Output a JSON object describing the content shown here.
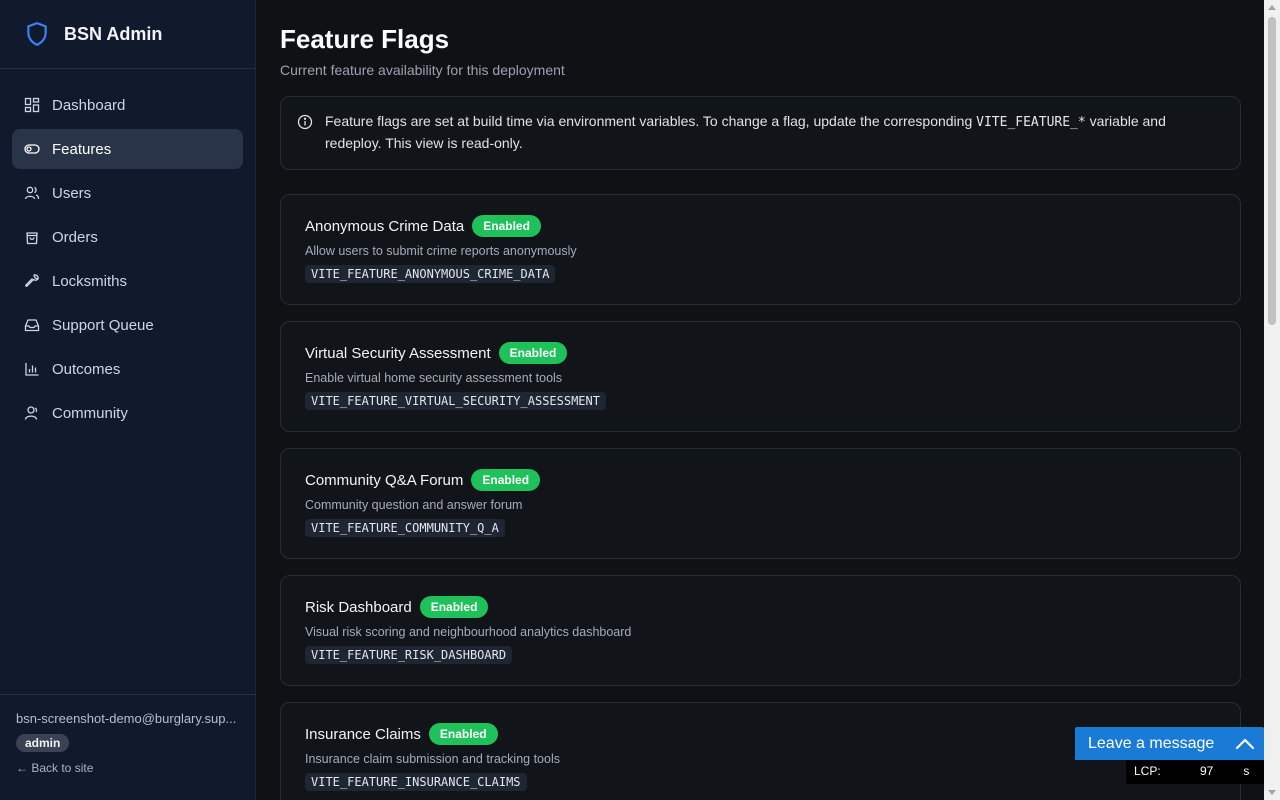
{
  "app": {
    "title": "BSN Admin"
  },
  "sidebar": {
    "items": [
      {
        "label": "Dashboard",
        "icon": "dashboard-icon"
      },
      {
        "label": "Features",
        "icon": "toggle-icon",
        "active": true
      },
      {
        "label": "Users",
        "icon": "users-icon"
      },
      {
        "label": "Orders",
        "icon": "bag-icon"
      },
      {
        "label": "Locksmiths",
        "icon": "wrench-icon"
      },
      {
        "label": "Support Queue",
        "icon": "inbox-icon"
      },
      {
        "label": "Outcomes",
        "icon": "bar-chart-icon"
      },
      {
        "label": "Community",
        "icon": "user-circle-icon"
      }
    ],
    "footer": {
      "email": "bsn-screenshot-demo@burglary.sup...",
      "role": "admin",
      "back_link": "← Back to site"
    }
  },
  "main": {
    "title": "Feature Flags",
    "subtitle": "Current feature availability for this deployment",
    "info": {
      "text_before": "Feature flags are set at build time via environment variables. To change a flag, update the corresponding ",
      "code": "VITE_FEATURE_*",
      "text_after": " variable and redeploy. This view is read-only."
    },
    "flags": [
      {
        "name": "Anonymous Crime Data",
        "status": "Enabled",
        "description": "Allow users to submit crime reports anonymously",
        "env": "VITE_FEATURE_ANONYMOUS_CRIME_DATA"
      },
      {
        "name": "Virtual Security Assessment",
        "status": "Enabled",
        "description": "Enable virtual home security assessment tools",
        "env": "VITE_FEATURE_VIRTUAL_SECURITY_ASSESSMENT"
      },
      {
        "name": "Community Q&A Forum",
        "status": "Enabled",
        "description": "Community question and answer forum",
        "env": "VITE_FEATURE_COMMUNITY_Q_A"
      },
      {
        "name": "Risk Dashboard",
        "status": "Enabled",
        "description": "Visual risk scoring and neighbourhood analytics dashboard",
        "env": "VITE_FEATURE_RISK_DASHBOARD"
      },
      {
        "name": "Insurance Claims",
        "status": "Enabled",
        "description": "Insurance claim submission and tracking tools",
        "env": "VITE_FEATURE_INSURANCE_CLAIMS"
      }
    ]
  },
  "chat": {
    "label": "Leave a message"
  },
  "lcp": {
    "label": "LCP:",
    "value": "97",
    "suffix": "s"
  },
  "colors": {
    "accent": "#1fc15a",
    "sidebar_bg": "#111a2c",
    "active_item": "#2a3448",
    "chat_blue": "#1a7bd6"
  }
}
